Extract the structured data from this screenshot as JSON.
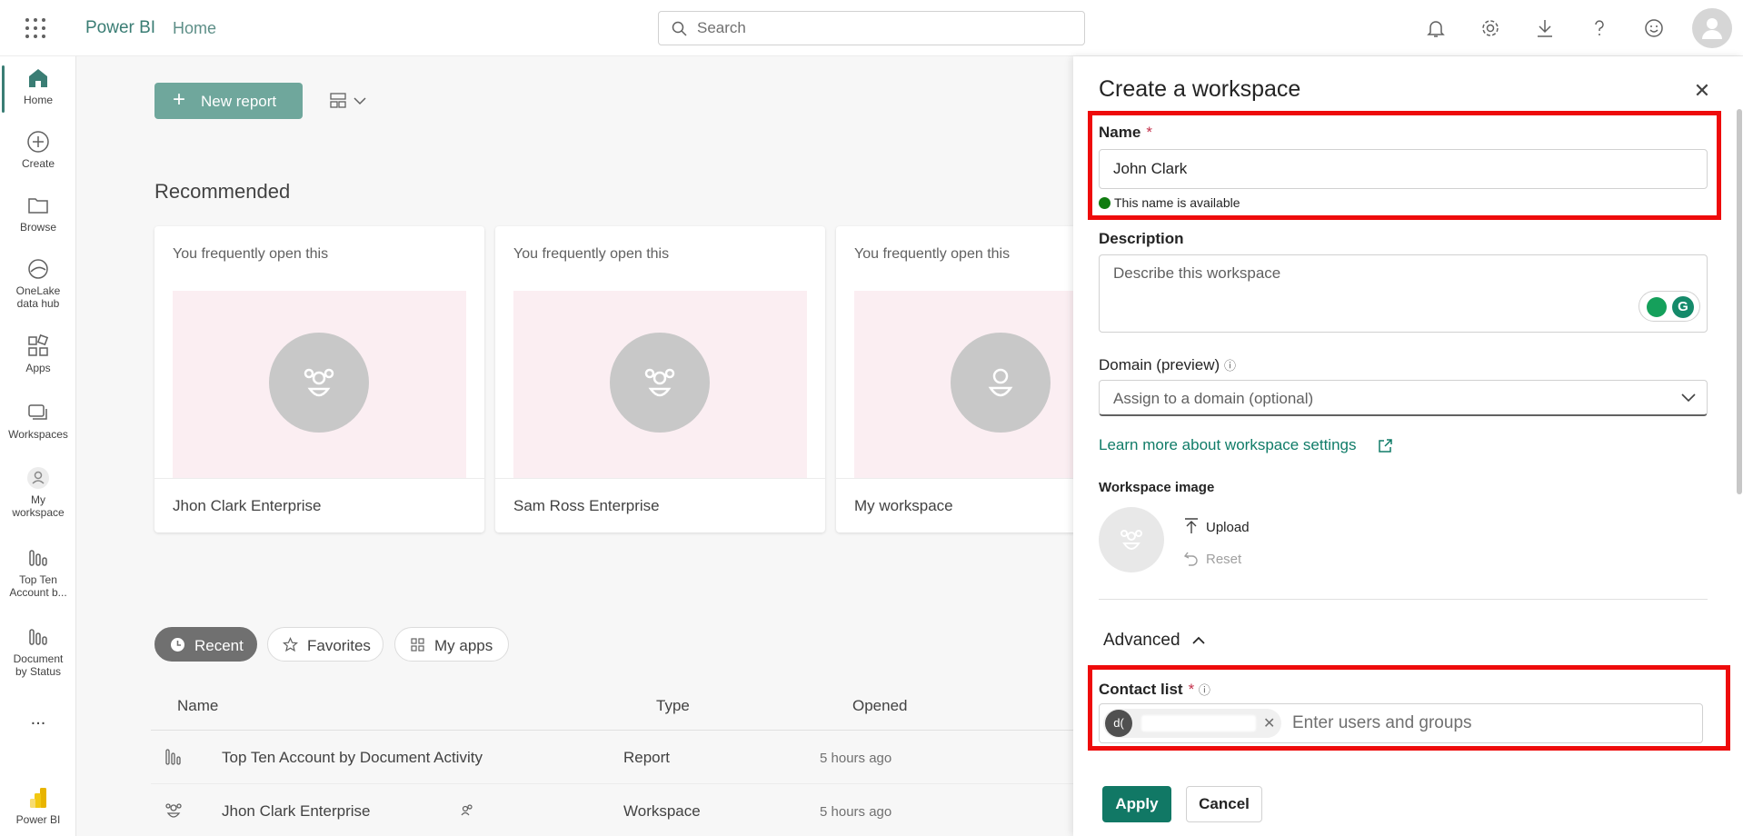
{
  "topbar": {
    "brand": "Power BI",
    "breadcrumb": "Home",
    "search_placeholder": "Search",
    "icons": [
      "bell-icon",
      "gear-icon",
      "download-icon",
      "help-icon",
      "feedback-icon",
      "account-icon"
    ]
  },
  "rail": {
    "items": [
      {
        "label": "Home",
        "icon": "home-icon"
      },
      {
        "label": "Create",
        "icon": "plus-circle-icon"
      },
      {
        "label": "Browse",
        "icon": "folder-icon"
      },
      {
        "label": "OneLake data hub",
        "line1": "OneLake",
        "line2": "data hub",
        "icon": "onelake-icon"
      },
      {
        "label": "Apps",
        "icon": "apps-icon"
      },
      {
        "label": "Workspaces",
        "icon": "workspaces-icon"
      },
      {
        "label": "My workspace",
        "line1": "My",
        "line2": "workspace",
        "icon": "person-icon"
      },
      {
        "label": "Top Ten Account b...",
        "line1": "Top Ten",
        "line2": "Account b...",
        "icon": "report-icon"
      },
      {
        "label": "Document by Status",
        "line1": "Document",
        "line2": "by Status",
        "icon": "report-icon"
      },
      {
        "label": "...",
        "icon": "more-icon"
      },
      {
        "label": "Power BI",
        "icon": "powerbi-logo-icon"
      }
    ]
  },
  "main": {
    "new_report_label": "New report",
    "recommended_title": "Recommended",
    "cards": [
      {
        "subtitle": "You frequently open this",
        "name": "Jhon Clark Enterprise"
      },
      {
        "subtitle": "You frequently open this",
        "name": "Sam Ross Enterprise"
      },
      {
        "subtitle": "You frequently open this",
        "name": "My workspace"
      }
    ],
    "tabs": [
      {
        "label": "Recent",
        "active": true
      },
      {
        "label": "Favorites",
        "active": false
      },
      {
        "label": "My apps",
        "active": false
      }
    ],
    "table": {
      "headers": {
        "name": "Name",
        "type": "Type",
        "opened": "Opened"
      },
      "rows": [
        {
          "name": "Top Ten Account by Document Activity",
          "type": "Report",
          "opened": "5 hours ago"
        },
        {
          "name": "Jhon Clark Enterprise",
          "type": "Workspace",
          "opened": "5 hours ago"
        }
      ]
    }
  },
  "panel": {
    "title": "Create a workspace",
    "name_label": "Name",
    "required_mark": "*",
    "name_value": "John Clark",
    "name_status": "This name is available",
    "description_label": "Description",
    "description_placeholder": "Describe this workspace",
    "domain_label": "Domain (preview)",
    "domain_value": "Assign to a domain (optional)",
    "learn_more": "Learn more about workspace settings",
    "workspace_image_label": "Workspace image",
    "upload_label": "Upload",
    "reset_label": "Reset",
    "advanced_label": "Advanced",
    "contact_label": "Contact list",
    "contact_avatar": "d(",
    "contact_placeholder": "Enter users and groups",
    "apply_label": "Apply",
    "cancel_label": "Cancel"
  },
  "colors": {
    "accent": "#117865",
    "brand_text": "#3a7d74",
    "highlight": "#ee0b0b",
    "thumb_bg": "#fbeef2"
  }
}
